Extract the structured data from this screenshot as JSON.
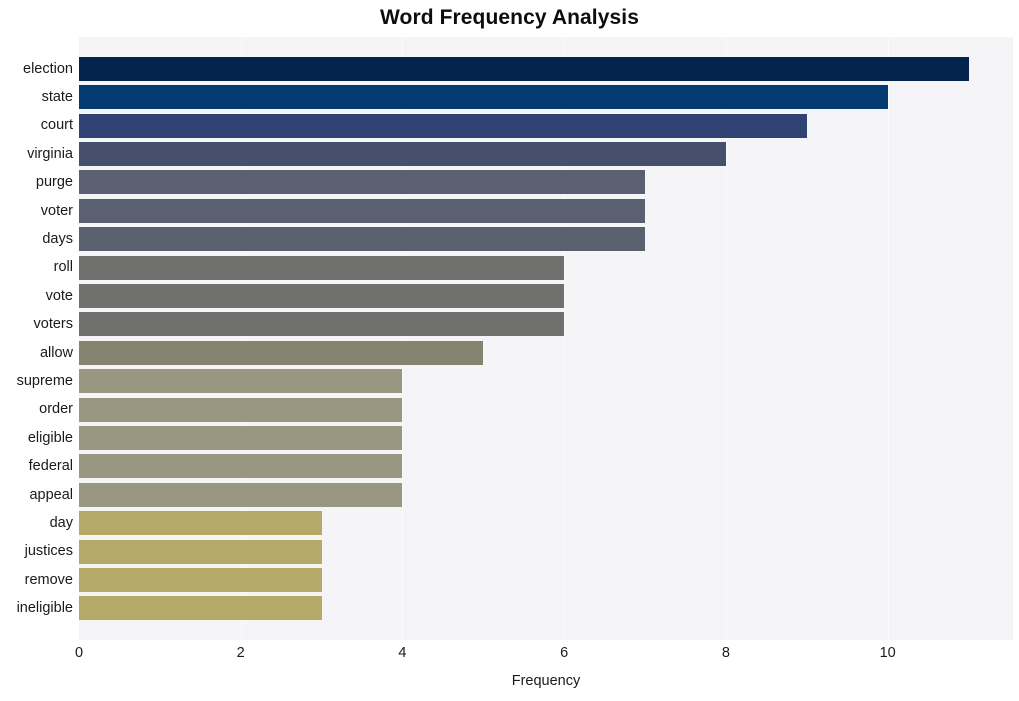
{
  "chart_data": {
    "type": "bar",
    "orientation": "horizontal",
    "title": "Word Frequency Analysis",
    "xlabel": "Frequency",
    "ylabel": "",
    "categories": [
      "election",
      "state",
      "court",
      "virginia",
      "purge",
      "voter",
      "days",
      "roll",
      "vote",
      "voters",
      "allow",
      "supreme",
      "order",
      "eligible",
      "federal",
      "appeal",
      "day",
      "justices",
      "remove",
      "ineligible"
    ],
    "values": [
      11,
      10,
      9,
      8,
      7,
      7,
      7,
      6,
      6,
      6,
      5,
      4,
      4,
      4,
      4,
      4,
      3,
      3,
      3,
      3
    ],
    "bar_colors": [
      "#03224c",
      "#033a72",
      "#2f4271",
      "#464f6e",
      "#5b6070",
      "#5b6070",
      "#5b6070",
      "#70716f",
      "#70716f",
      "#70716f",
      "#858471",
      "#9a9780",
      "#9a9780",
      "#9a9780",
      "#9a9780",
      "#9a9780",
      "#b5a96a",
      "#b5a96a",
      "#b5a96a",
      "#b5a96a"
    ],
    "xlim": [
      0,
      11.55
    ],
    "xticks": [
      0,
      2,
      4,
      6,
      8,
      10
    ],
    "xtick_labels": [
      "0",
      "2",
      "4",
      "6",
      "8",
      "10"
    ],
    "grid": true,
    "grid_axis": "x",
    "legend": null,
    "plot_background": "#f5f5f7",
    "figure_background": "#ffffff",
    "gridline_color": "#fbfbfc",
    "text_color": "#1a1a1a"
  }
}
